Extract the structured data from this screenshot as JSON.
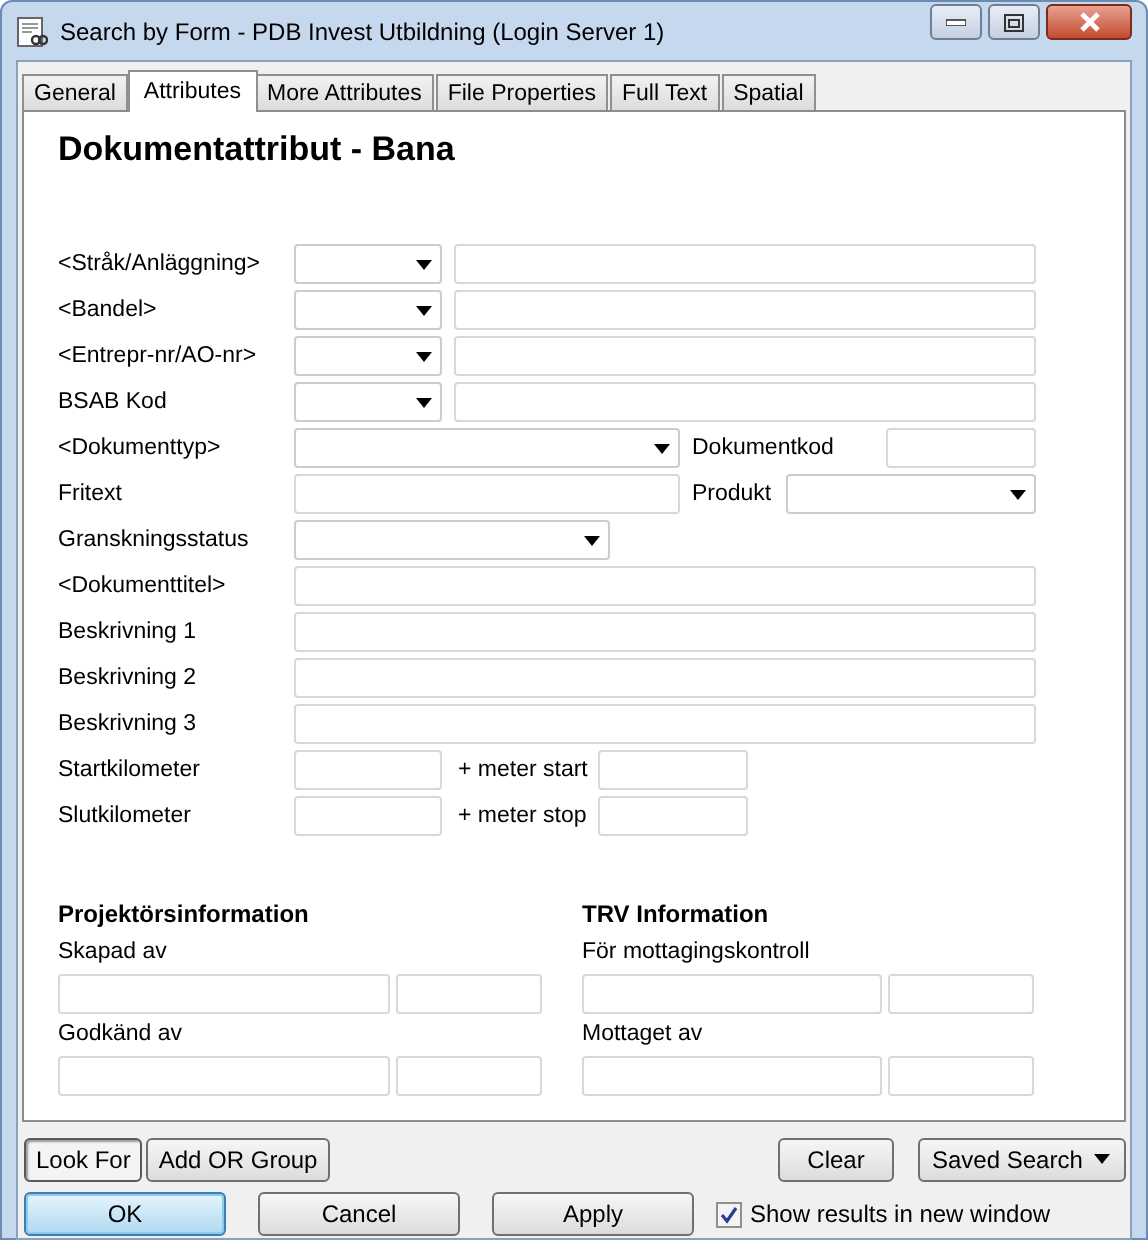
{
  "window": {
    "title": "Search by Form - PDB Invest Utbildning (Login Server 1)"
  },
  "tabs": [
    {
      "label": "General",
      "selected": false
    },
    {
      "label": "Attributes",
      "selected": true
    },
    {
      "label": "More Attributes",
      "selected": false
    },
    {
      "label": "File Properties",
      "selected": false
    },
    {
      "label": "Full Text",
      "selected": false
    },
    {
      "label": "Spatial",
      "selected": false
    }
  ],
  "form": {
    "heading": "Dokumentattribut - Bana",
    "rows": [
      {
        "label": "<Stråk/Anläggning>",
        "kind": "combo-text"
      },
      {
        "label": "<Bandel>",
        "kind": "combo-text"
      },
      {
        "label": "<Entrepr-nr/AO-nr>",
        "kind": "combo-text"
      },
      {
        "label": "BSAB Kod",
        "kind": "combo-text"
      },
      {
        "label": "<Dokumenttyp>",
        "kind": "combo-label-text",
        "label2": "Dokumentkod"
      },
      {
        "label": "Fritext",
        "kind": "text-label-combo",
        "label2": "Produkt"
      },
      {
        "label": "Granskningsstatus",
        "kind": "combo"
      },
      {
        "label": "<Dokumenttitel>",
        "kind": "text"
      },
      {
        "label": "Beskrivning 1",
        "kind": "text"
      },
      {
        "label": "Beskrivning 2",
        "kind": "text"
      },
      {
        "label": "Beskrivning 3",
        "kind": "text"
      },
      {
        "label": "Startkilometer",
        "kind": "text-label-text",
        "label2": "+ meter start"
      },
      {
        "label": "Slutkilometer",
        "kind": "text-label-text",
        "label2": "+ meter stop"
      }
    ],
    "sections": [
      {
        "heading": "Projektörsinformation",
        "groups": [
          {
            "label": "Skapad av"
          },
          {
            "label": "Godkänd av"
          }
        ]
      },
      {
        "heading": "TRV Information",
        "groups": [
          {
            "label": "För mottagingskontroll"
          },
          {
            "label": "Mottaget av"
          }
        ]
      }
    ]
  },
  "mode_buttons": [
    {
      "label": "Look For",
      "selected": true
    },
    {
      "label": "Add OR Group",
      "selected": false
    }
  ],
  "clear_button": "Clear",
  "saved_search_button": "Saved Search",
  "buttons": [
    {
      "label": "OK",
      "default": true
    },
    {
      "label": "Cancel",
      "default": false
    },
    {
      "label": "Apply",
      "default": false
    }
  ],
  "show_results": {
    "label": "Show results in new window",
    "checked": true
  }
}
